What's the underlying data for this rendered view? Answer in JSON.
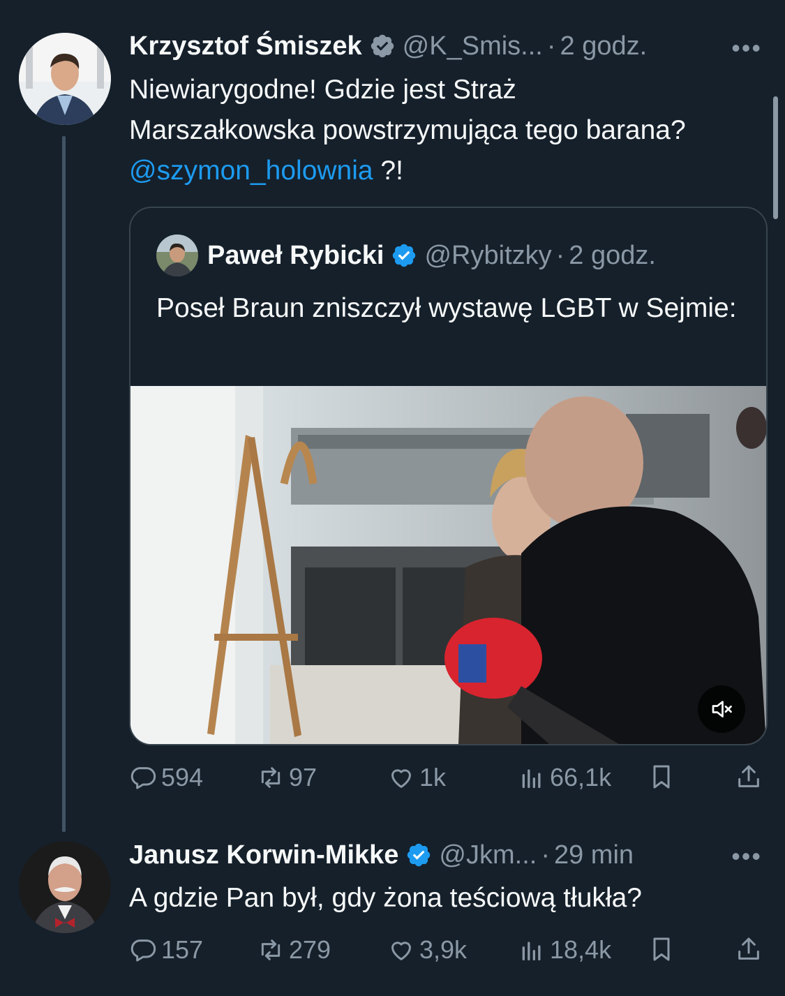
{
  "tweet1": {
    "name": "Krzysztof Śmiszek",
    "handle": "@K_Smis...",
    "dot": "·",
    "time": "2 godz.",
    "text_before": "Niewiarygodne! Gdzie jest Straż Marszałkowska powstrzymująca tego barana? ",
    "mention": "@szymon_holownia",
    "text_after": " ?!",
    "stats": {
      "replies": "594",
      "reposts": "97",
      "likes": "1k",
      "views": "66,1k"
    }
  },
  "quote": {
    "name": "Paweł Rybicki",
    "handle": "@Rybitzky",
    "dot": "·",
    "time": "2 godz.",
    "text": "Poseł Braun zniszczył wystawę LGBT w Sejmie:"
  },
  "tweet2": {
    "name": "Janusz Korwin-Mikke",
    "handle": "@Jkm...",
    "dot": "·",
    "time": "29 min",
    "text": "A gdzie Pan był, gdy żona teściową tłukła?",
    "stats": {
      "replies": "157",
      "reposts": "279",
      "likes": "3,9k",
      "views": "18,4k"
    }
  },
  "more_label": "•••",
  "colors": {
    "background": "#15202b",
    "accent": "#1d9bf0",
    "muted": "#8b98a5",
    "border": "#38444d"
  }
}
